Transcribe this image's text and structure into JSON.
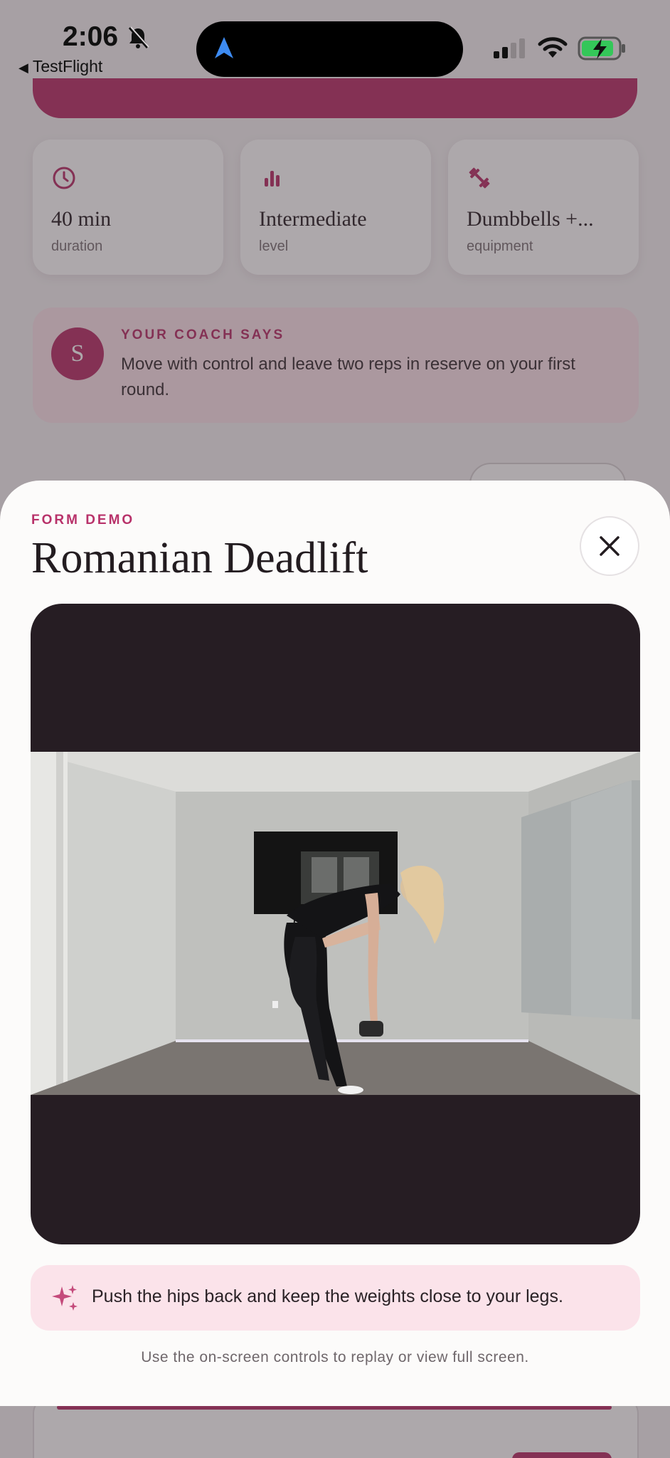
{
  "status_bar": {
    "time": "2:06",
    "back_app": "TestFlight"
  },
  "background": {
    "stats": [
      {
        "icon": "clock-icon",
        "value": "40 min",
        "label": "duration"
      },
      {
        "icon": "bar-chart-icon",
        "value": "Intermediate",
        "label": "level"
      },
      {
        "icon": "dumbbell-icon",
        "value": "Dumbbells +...",
        "label": "equipment"
      }
    ],
    "coach": {
      "avatar_initial": "S",
      "title": "YOUR COACH SAYS",
      "message": "Move with control and leave two reps in reserve on your first round."
    }
  },
  "sheet": {
    "eyebrow": "FORM DEMO",
    "title": "Romanian Deadlift",
    "tip": "Push the hips back and keep the weights close to your legs.",
    "hint": "Use the on-screen controls to replay or view full screen."
  },
  "colors": {
    "accent": "#b8326a",
    "tip_background": "#fbe3ea",
    "video_background": "#261d23"
  }
}
